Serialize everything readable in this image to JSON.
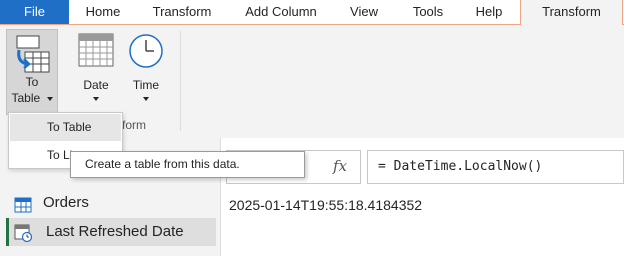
{
  "tabs": {
    "file": "File",
    "home": "Home",
    "transform": "Transform",
    "add_column": "Add Column",
    "view": "View",
    "tools": "Tools",
    "help": "Help",
    "context_transform": "Transform"
  },
  "ribbon": {
    "to_table_line1": "To",
    "to_table_line2": "Table",
    "date_label": "Date",
    "time_label": "Time",
    "group_label_partial": "form"
  },
  "dropdown": {
    "item1": "To Table",
    "item2_partial": "To Li"
  },
  "tooltip": "Create a table from this data.",
  "formula_bar": {
    "fx": "fx",
    "formula": "= DateTime.LocalNow()"
  },
  "result_value": "2025-01-14T19:55:18.4184352",
  "queries": [
    {
      "name": "Orders"
    },
    {
      "name": "Last Refreshed Date"
    }
  ],
  "colors": {
    "file_tab": "#1e6fc5",
    "context_tab_border": "#f0a582",
    "selected_indicator": "#217346"
  }
}
